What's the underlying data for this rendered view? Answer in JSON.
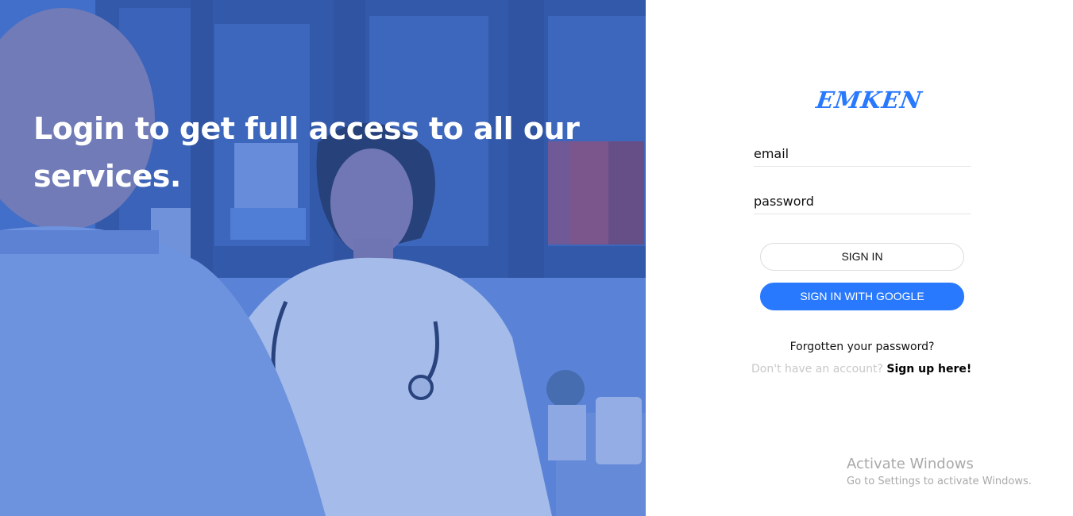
{
  "hero": {
    "headline": "Login to get full access to all our services.",
    "overlay_color": "#3d6ccf"
  },
  "login": {
    "brand": "EMKEN",
    "email_placeholder": "email",
    "password_placeholder": "password",
    "signin_label": "SIGN IN",
    "google_label": "SIGN IN WITH GOOGLE",
    "forgot_label": "Forgotten your password?",
    "signup_prompt": "Don't have an account?",
    "signup_link": "Sign up here!",
    "accent_color": "#2979ff"
  },
  "watermark": {
    "title": "Activate Windows",
    "subtitle": "Go to Settings to activate Windows."
  }
}
